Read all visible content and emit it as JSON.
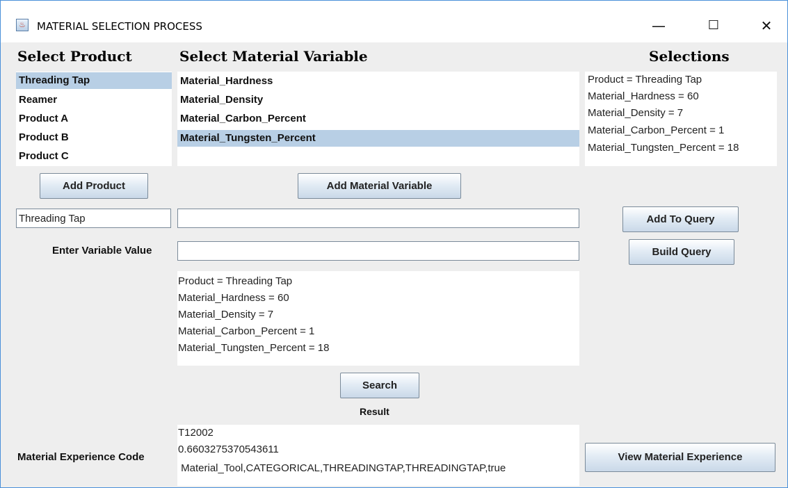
{
  "window": {
    "title": "MATERIAL SELECTION PROCESS",
    "icon": "java-coffee-icon",
    "controls": {
      "minimize": "—",
      "maximize": "☐",
      "close": "✕"
    }
  },
  "headers": {
    "product": "Select Product",
    "variable": "Select Material Variable",
    "selections": "Selections"
  },
  "products": {
    "items": [
      "Threading Tap",
      "Reamer",
      "Product A",
      "Product B",
      "Product C"
    ],
    "selected": "Threading Tap"
  },
  "variables": {
    "items": [
      "Material_Hardness",
      "Material_Density",
      "Material_Carbon_Percent",
      "Material_Tungsten_Percent"
    ],
    "selected": "Material_Tungsten_Percent"
  },
  "selections": {
    "lines": [
      "Product = Threading Tap",
      "Material_Hardness = 60",
      "Material_Density = 7",
      "Material_Carbon_Percent = 1",
      "Material_Tungsten_Percent = 18"
    ]
  },
  "buttons": {
    "add_product": "Add Product",
    "add_variable": "Add Material Variable",
    "add_to_query": "Add To Query",
    "build_query": "Build Query",
    "search": "Search",
    "view_experience": "View Material Experience"
  },
  "fields": {
    "product_value": "Threading Tap",
    "variable_name": "",
    "variable_value": ""
  },
  "labels": {
    "enter_value": "Enter Variable Value",
    "result": "Result",
    "experience_code": "Material Experience Code"
  },
  "query": {
    "lines": [
      "Product = Threading Tap",
      "Material_Hardness = 60",
      "Material_Density = 7",
      "Material_Carbon_Percent = 1",
      "Material_Tungsten_Percent = 18"
    ]
  },
  "result": {
    "lines": [
      "T12002",
      "0.6603275370543611",
      " Material_Tool,CATEGORICAL,THREADINGTAP,THREADINGTAP,true"
    ]
  }
}
